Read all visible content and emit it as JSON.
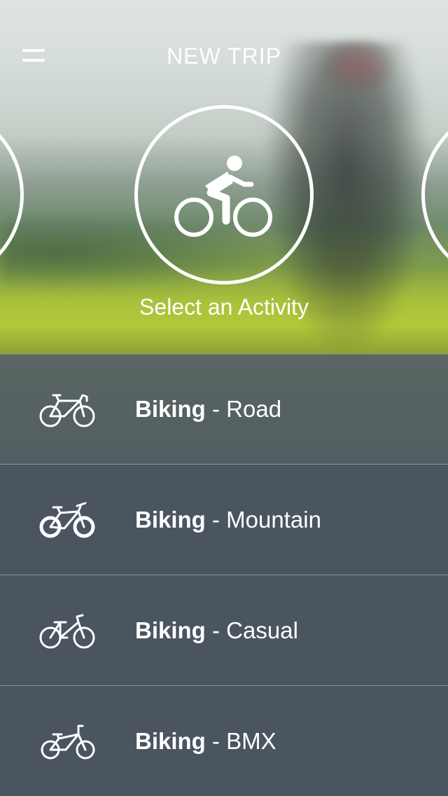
{
  "header": {
    "title": "NEW TRIP"
  },
  "hero": {
    "selected_activity_icon": "cycling-person-icon",
    "select_label": "Select an Activity"
  },
  "activities": [
    {
      "category": "Biking",
      "separator": " - ",
      "type": "Road",
      "icon": "road-bike-icon"
    },
    {
      "category": "Biking",
      "separator": " - ",
      "type": "Mountain",
      "icon": "mountain-bike-icon"
    },
    {
      "category": "Biking",
      "separator": " - ",
      "type": "Casual",
      "icon": "casual-bike-icon"
    },
    {
      "category": "Biking",
      "separator": " - ",
      "type": "BMX",
      "icon": "bmx-bike-icon"
    }
  ],
  "colors": {
    "list_background": "#4b5560",
    "text": "#ffffff"
  }
}
